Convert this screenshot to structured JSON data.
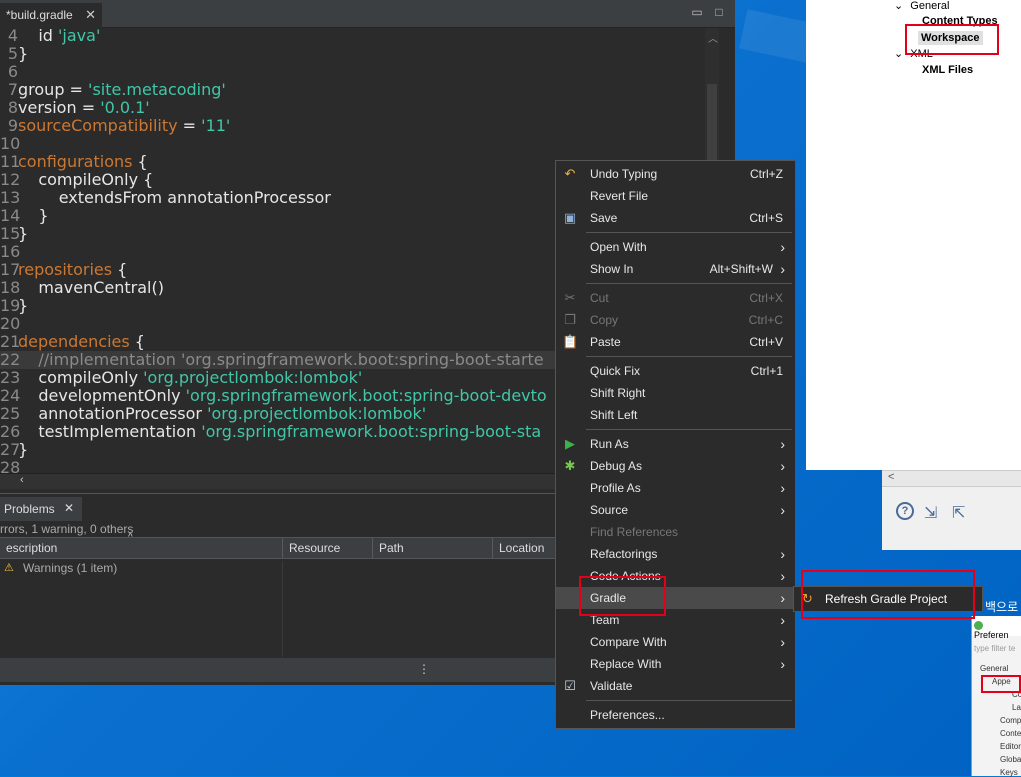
{
  "editor": {
    "tab_title": "*build.gradle",
    "tab_close": "✕",
    "lines": [
      {
        "n": "4",
        "parts": [
          {
            "t": "    id ",
            "c": ""
          },
          {
            "t": "'java'",
            "c": "str"
          }
        ]
      },
      {
        "n": "5",
        "parts": [
          {
            "t": "}",
            "c": ""
          }
        ]
      },
      {
        "n": "6",
        "parts": []
      },
      {
        "n": "7",
        "parts": [
          {
            "t": "group = ",
            "c": ""
          },
          {
            "t": "'site.metacoding'",
            "c": "str"
          }
        ]
      },
      {
        "n": "8",
        "parts": [
          {
            "t": "version = ",
            "c": ""
          },
          {
            "t": "'0.0.1'",
            "c": "str"
          }
        ]
      },
      {
        "n": "9",
        "parts": [
          {
            "t": "sourceCompatibility",
            "c": "kw"
          },
          {
            "t": " = ",
            "c": ""
          },
          {
            "t": "'11'",
            "c": "str"
          }
        ]
      },
      {
        "n": "10",
        "parts": []
      },
      {
        "n": "11",
        "parts": [
          {
            "t": "configurations",
            "c": "kw"
          },
          {
            "t": " {",
            "c": ""
          }
        ]
      },
      {
        "n": "12",
        "parts": [
          {
            "t": "    compileOnly {",
            "c": ""
          }
        ]
      },
      {
        "n": "13",
        "parts": [
          {
            "t": "        extendsFrom annotationProcessor",
            "c": ""
          }
        ]
      },
      {
        "n": "14",
        "parts": [
          {
            "t": "    }",
            "c": ""
          }
        ]
      },
      {
        "n": "15",
        "parts": [
          {
            "t": "}",
            "c": ""
          }
        ]
      },
      {
        "n": "16",
        "parts": []
      },
      {
        "n": "17",
        "parts": [
          {
            "t": "repositories",
            "c": "kw"
          },
          {
            "t": " {",
            "c": ""
          }
        ]
      },
      {
        "n": "18",
        "parts": [
          {
            "t": "    mavenCentral()",
            "c": ""
          }
        ]
      },
      {
        "n": "19",
        "parts": [
          {
            "t": "}",
            "c": ""
          }
        ]
      },
      {
        "n": "20",
        "parts": []
      },
      {
        "n": "21",
        "parts": [
          {
            "t": "dependencies",
            "c": "kw"
          },
          {
            "t": " {",
            "c": ""
          }
        ]
      },
      {
        "n": "22",
        "parts": [
          {
            "t": "    //implementation 'org.springframework.boot:spring-boot-starte",
            "c": "cm"
          }
        ],
        "hl": true
      },
      {
        "n": "23",
        "parts": [
          {
            "t": "    compileOnly ",
            "c": ""
          },
          {
            "t": "'org.projectlombok:lombok'",
            "c": "str"
          }
        ]
      },
      {
        "n": "24",
        "parts": [
          {
            "t": "    developmentOnly ",
            "c": ""
          },
          {
            "t": "'org.springframework.boot:spring-boot-devto",
            "c": "str"
          }
        ]
      },
      {
        "n": "25",
        "parts": [
          {
            "t": "    annotationProcessor ",
            "c": ""
          },
          {
            "t": "'org.projectlombok:lombok'",
            "c": "str"
          }
        ]
      },
      {
        "n": "26",
        "parts": [
          {
            "t": "    testImplementation ",
            "c": ""
          },
          {
            "t": "'org.springframework.boot:spring-boot-sta",
            "c": "str"
          }
        ]
      },
      {
        "n": "27",
        "parts": [
          {
            "t": "}",
            "c": ""
          }
        ]
      },
      {
        "n": "28",
        "parts": []
      }
    ]
  },
  "problems": {
    "tab_label": "Problems",
    "tab_close": "✕",
    "summary": "rrors, 1 warning, 0 others",
    "columns": [
      "escription",
      "Resource",
      "Path",
      "Location"
    ],
    "row": "Warnings (1 item)"
  },
  "right_tree": {
    "general": "General",
    "content_types": "Content Types",
    "workspace": "Workspace",
    "xml": "XML",
    "xml_files": "XML Files"
  },
  "context_menu": {
    "items": [
      {
        "label": "Undo Typing",
        "acc": "Ctrl+Z",
        "icon": "undo-icon",
        "glyph": "↶",
        "color": "#e8b04a"
      },
      {
        "label": "Revert File",
        "acc": "",
        "icon": "",
        "glyph": ""
      },
      {
        "label": "Save",
        "acc": "Ctrl+S",
        "icon": "save-icon",
        "glyph": "▣",
        "color": "#8fb0d8"
      },
      {
        "sep": true
      },
      {
        "label": "Open With",
        "acc": "",
        "arrow": true
      },
      {
        "label": "Show In",
        "acc": "Alt+Shift+W",
        "arrow": true
      },
      {
        "sep": true
      },
      {
        "label": "Cut",
        "acc": "Ctrl+X",
        "disabled": true,
        "icon": "cut-icon",
        "glyph": "✂",
        "color": "#777"
      },
      {
        "label": "Copy",
        "acc": "Ctrl+C",
        "disabled": true,
        "icon": "copy-icon",
        "glyph": "❐",
        "color": "#777"
      },
      {
        "label": "Paste",
        "acc": "Ctrl+V",
        "icon": "paste-icon",
        "glyph": "📋",
        "color": "#c9a060"
      },
      {
        "sep": true
      },
      {
        "label": "Quick Fix",
        "acc": "Ctrl+1"
      },
      {
        "label": "Shift Right",
        "acc": ""
      },
      {
        "label": "Shift Left",
        "acc": ""
      },
      {
        "sep": true
      },
      {
        "label": "Run As",
        "acc": "",
        "arrow": true,
        "icon": "run-icon",
        "glyph": "▶",
        "color": "#3cb34a"
      },
      {
        "label": "Debug As",
        "acc": "",
        "arrow": true,
        "icon": "bug-icon",
        "glyph": "✱",
        "color": "#78c850"
      },
      {
        "label": "Profile As",
        "acc": "",
        "arrow": true
      },
      {
        "label": "Source",
        "acc": "",
        "arrow": true
      },
      {
        "label": "Find References",
        "acc": "",
        "disabled": true
      },
      {
        "label": "Refactorings",
        "acc": "",
        "arrow": true
      },
      {
        "label": "Code Actions",
        "acc": "",
        "arrow": true
      },
      {
        "label": "Gradle",
        "acc": "",
        "arrow": true,
        "selected": true
      },
      {
        "label": "Team",
        "acc": "",
        "arrow": true
      },
      {
        "label": "Compare With",
        "acc": "",
        "arrow": true
      },
      {
        "label": "Replace With",
        "acc": "",
        "arrow": true
      },
      {
        "label": "Validate",
        "acc": "",
        "icon": "check-icon",
        "glyph": "☑",
        "color": "#cfd8e8"
      },
      {
        "sep": true
      },
      {
        "label": "Preferences...",
        "acc": ""
      }
    ]
  },
  "submenu": {
    "label": "Refresh Gradle Project"
  },
  "korean_text": "백으로",
  "pref_window": {
    "title": "Preferen",
    "filter": "type filter te",
    "items": [
      "General",
      "Appe",
      "Co",
      "La",
      "Comp",
      "Conte",
      "Editor",
      "Globa",
      "Keys"
    ]
  },
  "colors": {
    "highlight_box": "#e3001b",
    "menu_bg": "#2b2b2b",
    "keyword": "#cc7832",
    "string": "#41c7a8"
  }
}
